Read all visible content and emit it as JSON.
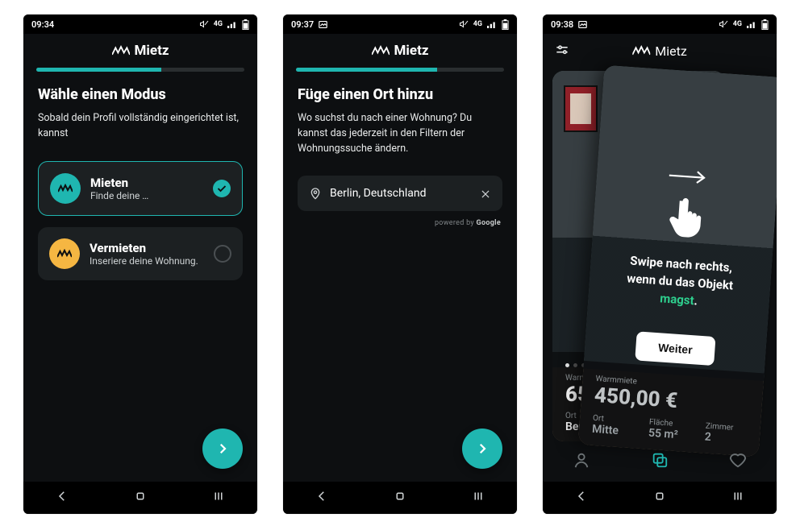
{
  "brand": "Mietz",
  "colors": {
    "accent": "#1fb6b0",
    "amber": "#f5b642",
    "green": "#2ecf8e"
  },
  "screens": {
    "s1": {
      "time": "09:34",
      "progress_pct": 60,
      "title": "Wähle einen Modus",
      "subtitle": "Sobald dein Profil vollständig eingerichtet ist, kannst",
      "options": [
        {
          "title": "Mieten",
          "subtitle": "Finde deine …",
          "selected": true
        },
        {
          "title": "Vermieten",
          "subtitle": "Inseriere deine Wohnung.",
          "selected": false
        }
      ]
    },
    "s2": {
      "time": "09:37",
      "progress_pct": 68,
      "title": "Füge einen Ort hinzu",
      "subtitle": "Wo suchst du nach einer Wohnung? Du kannst das jederzeit in den Filtern der Wohnungssuche ändern.",
      "location": "Berlin, Deutschland",
      "powered_prefix": "powered by ",
      "powered_brand": "Google"
    },
    "s3": {
      "time": "09:38",
      "swipe_line1": "Swipe nach rechts,",
      "swipe_line2": "wenn du das Objekt",
      "swipe_highlight": "magst",
      "swipe_suffix": ".",
      "cta": "Weiter",
      "back_card": {
        "rent_label": "Warm",
        "rent_value": "65",
        "loc_label": "Ort",
        "loc_value": "Berli"
      },
      "front_card": {
        "rent_label": "Warmmiete",
        "rent_value": "450,00 €",
        "labels": {
          "loc": "Ort",
          "area": "Fläche",
          "rooms": "Zimmer"
        },
        "values": {
          "loc": "Mitte",
          "area": "55 m²",
          "rooms": "2"
        }
      }
    }
  }
}
